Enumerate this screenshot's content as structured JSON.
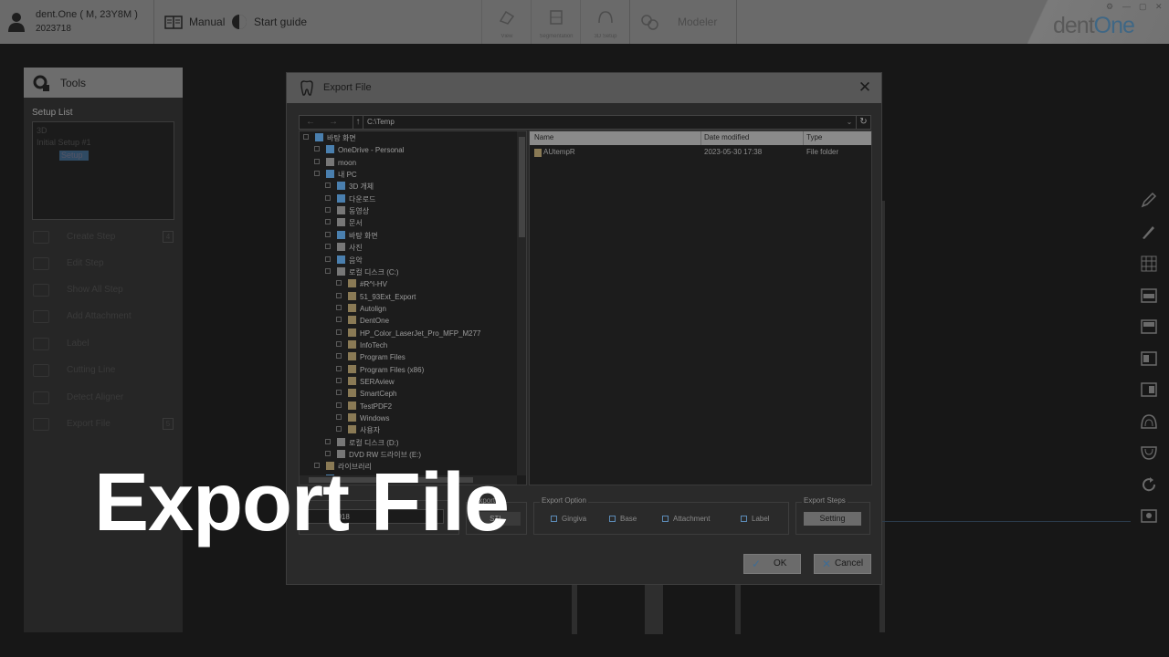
{
  "header": {
    "user_name": "dent.One ( M, 23Y8M )",
    "user_id": "2023718",
    "manual_label": "Manual",
    "start_guide_label": "Start guide",
    "mode_tabs": [
      "View",
      "Segmentation",
      "3D Setup"
    ],
    "modeler_label": "Modeler",
    "brand_prefix": "dent",
    "brand_suffix": "One"
  },
  "tools_panel": {
    "title": "Tools",
    "setup_list_label": "Setup List",
    "setup_items": [
      "3D",
      "Initial Setup #1",
      "Setup"
    ],
    "items": [
      {
        "label": "Create Step",
        "key": "4"
      },
      {
        "label": "Edit Step",
        "key": ""
      },
      {
        "label": "Show All Step",
        "key": ""
      },
      {
        "label": "Add Attachment",
        "key": ""
      },
      {
        "label": "Label",
        "key": ""
      },
      {
        "label": "Cutting Line",
        "key": ""
      },
      {
        "label": "Detect Aligner",
        "key": ""
      },
      {
        "label": "Export File",
        "key": "5"
      }
    ]
  },
  "dialog": {
    "title": "Export File",
    "close_glyph": "✕",
    "address_path": "C:\\Temp",
    "tree": [
      {
        "label": "바탕 화면",
        "level": 0,
        "icon": "blue"
      },
      {
        "label": "OneDrive - Personal",
        "level": 1,
        "icon": "blue"
      },
      {
        "label": "moon",
        "level": 1,
        "icon": "grey"
      },
      {
        "label": "내 PC",
        "level": 1,
        "icon": "blue"
      },
      {
        "label": "3D 개체",
        "level": 2,
        "icon": "blue"
      },
      {
        "label": "다운로드",
        "level": 2,
        "icon": "blue"
      },
      {
        "label": "동영상",
        "level": 2,
        "icon": "grey"
      },
      {
        "label": "문서",
        "level": 2,
        "icon": "grey"
      },
      {
        "label": "바탕 화면",
        "level": 2,
        "icon": "blue"
      },
      {
        "label": "사진",
        "level": 2,
        "icon": "grey"
      },
      {
        "label": "음악",
        "level": 2,
        "icon": "blue"
      },
      {
        "label": "로컬 디스크 (C:)",
        "level": 2,
        "icon": "grey"
      },
      {
        "label": "#R^I-HV",
        "level": 3,
        "icon": "folder"
      },
      {
        "label": "51_93Ext_Export",
        "level": 3,
        "icon": "folder"
      },
      {
        "label": "Autolign",
        "level": 3,
        "icon": "folder"
      },
      {
        "label": "DentOne",
        "level": 3,
        "icon": "folder"
      },
      {
        "label": "HP_Color_LaserJet_Pro_MFP_M277",
        "level": 3,
        "icon": "folder"
      },
      {
        "label": "InfoTech",
        "level": 3,
        "icon": "folder"
      },
      {
        "label": "Program Files",
        "level": 3,
        "icon": "folder"
      },
      {
        "label": "Program Files (x86)",
        "level": 3,
        "icon": "folder"
      },
      {
        "label": "SERAview",
        "level": 3,
        "icon": "folder"
      },
      {
        "label": "SmartCeph",
        "level": 3,
        "icon": "folder"
      },
      {
        "label": "TestPDF2",
        "level": 3,
        "icon": "folder"
      },
      {
        "label": "Windows",
        "level": 3,
        "icon": "folder"
      },
      {
        "label": "사용자",
        "level": 3,
        "icon": "folder"
      },
      {
        "label": "로컬 디스크 (D:)",
        "level": 2,
        "icon": "grey"
      },
      {
        "label": "DVD RW 드라이브 (E:)",
        "level": 2,
        "icon": "grey"
      },
      {
        "label": "라이브러리",
        "level": 1,
        "icon": "folder"
      },
      {
        "label": "네트워크",
        "level": 1,
        "icon": "blue"
      }
    ],
    "columns": [
      "Name",
      "Date modified",
      "Type"
    ],
    "files": [
      {
        "name": "AUtempR",
        "date": "2023-05-30 17:38",
        "type": "File folder"
      }
    ],
    "file_name_value": "0918",
    "export_group_label": "Export",
    "export_format": "STL",
    "export_option_label": "Export Option",
    "options": [
      "Gingiva",
      "Base",
      "Attachment",
      "Label"
    ],
    "export_steps_label": "Export Steps",
    "setting_label": "Setting",
    "ok_label": "OK",
    "ok_glyph": "✓",
    "cancel_label": "Cancel",
    "cancel_glyph": "✕"
  },
  "overlay_caption": "Export File"
}
